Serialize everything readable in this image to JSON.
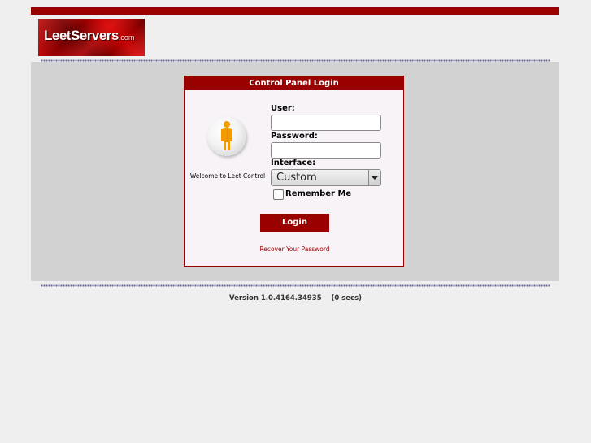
{
  "brand": {
    "name": "LeetServers",
    "suffix": ".com"
  },
  "panel": {
    "title": "Control Panel Login",
    "welcome": "Welcome to Leet Control",
    "user_label": "User:",
    "user_value": "",
    "password_label": "Password:",
    "password_value": "",
    "interface_label": "Interface:",
    "interface_selected": "Custom",
    "remember_label": "Remember Me",
    "login_label": "Login",
    "recover_label": "Recover Your Password"
  },
  "footer": {
    "version": "Version 1.0.4164.34935",
    "timing": "(0 secs)"
  },
  "colors": {
    "accent": "#990000",
    "background": "#efefef",
    "content_bg": "#d2d2d2",
    "panel_bg": "#f8f3f7"
  },
  "icons": {
    "avatar": "person-icon",
    "dropdown": "chevron-down-icon"
  }
}
